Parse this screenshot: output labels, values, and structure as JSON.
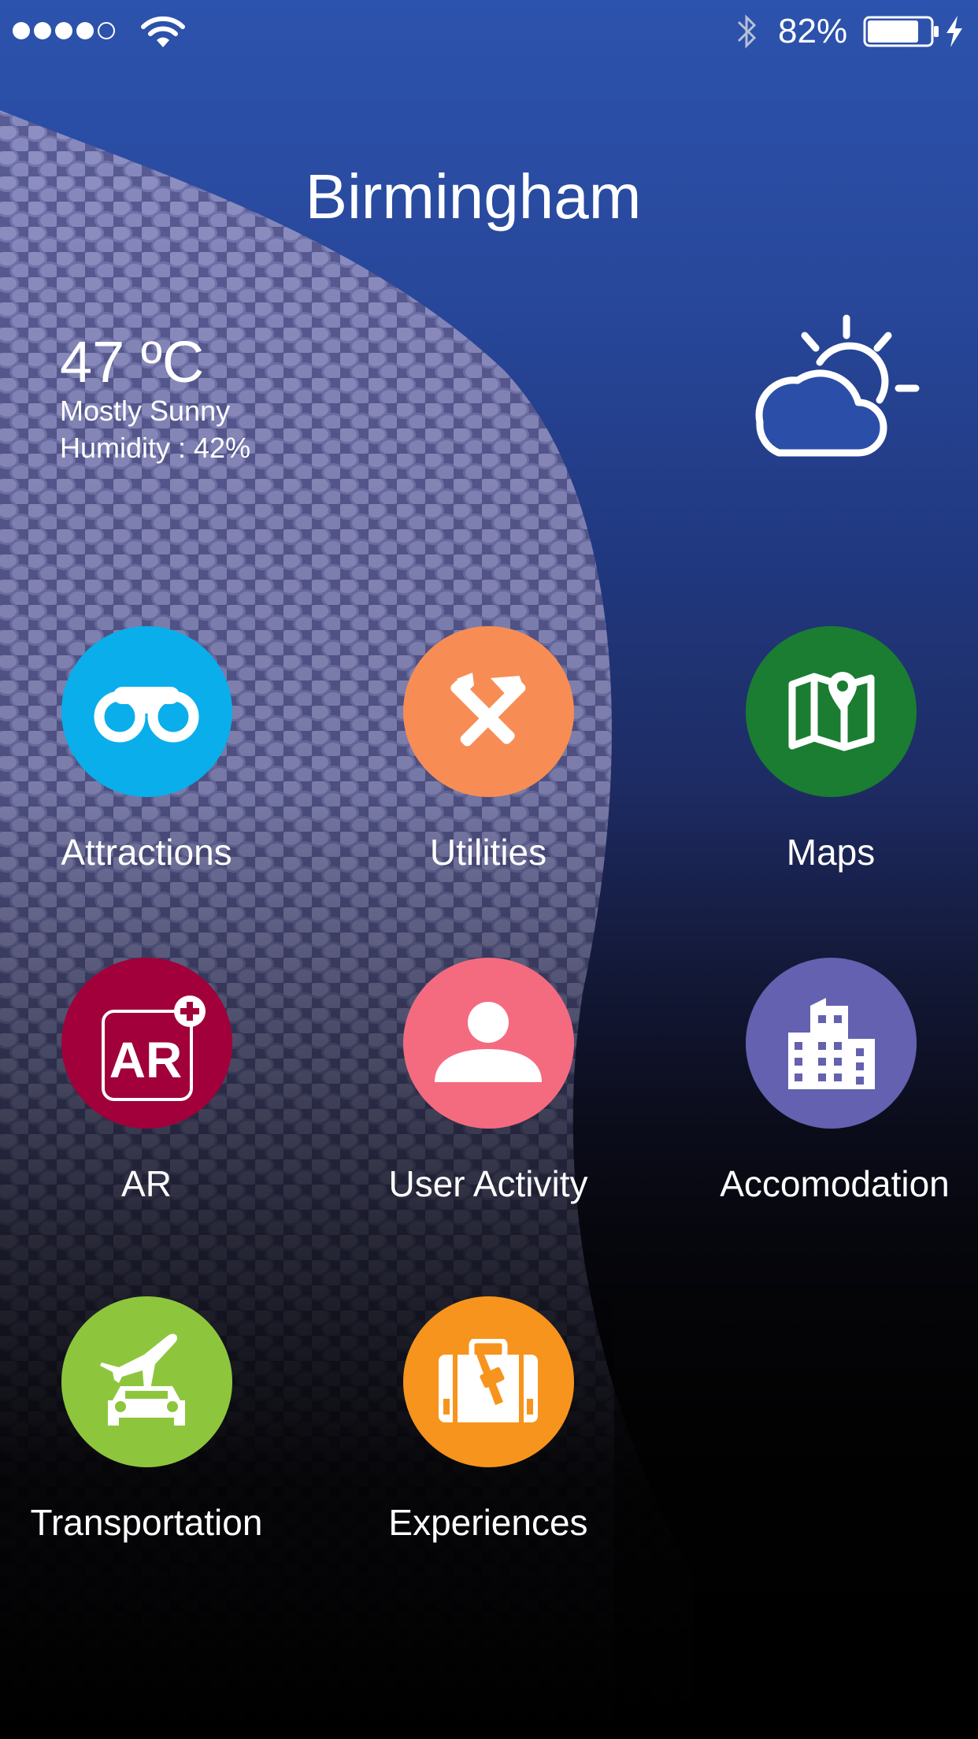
{
  "status_bar": {
    "signal_filled": 4,
    "signal_total": 5,
    "battery_percent": "82%",
    "battery_level": 0.82,
    "icons": [
      "signal-dots-icon",
      "wifi-icon",
      "bluetooth-icon",
      "battery-icon",
      "charging-bolt-icon"
    ]
  },
  "header": {
    "city": "Birmingham"
  },
  "weather": {
    "temperature": "47 ºC",
    "condition": "Mostly Sunny",
    "humidity": "Humidity : 42%",
    "icon": "partly-sunny-icon"
  },
  "menu": [
    {
      "label": "Attractions",
      "icon": "binoculars-icon",
      "color": "#0aaeea"
    },
    {
      "label": "Utilities",
      "icon": "tools-icon",
      "color": "#f78d55"
    },
    {
      "label": "Maps",
      "icon": "map-pin-icon",
      "color": "#1a7d31"
    },
    {
      "label": "AR",
      "icon": "ar-plus-icon",
      "color": "#a1003a"
    },
    {
      "label": "User Activity",
      "icon": "user-icon",
      "color": "#f46b80"
    },
    {
      "label": "Accomodation",
      "icon": "building-icon",
      "color": "#6461b0"
    },
    {
      "label": "Transportation",
      "icon": "plane-car-icon",
      "color": "#8dc63c"
    },
    {
      "label": "Experiences",
      "icon": "suitcase-icon",
      "color": "#f7941d"
    }
  ]
}
